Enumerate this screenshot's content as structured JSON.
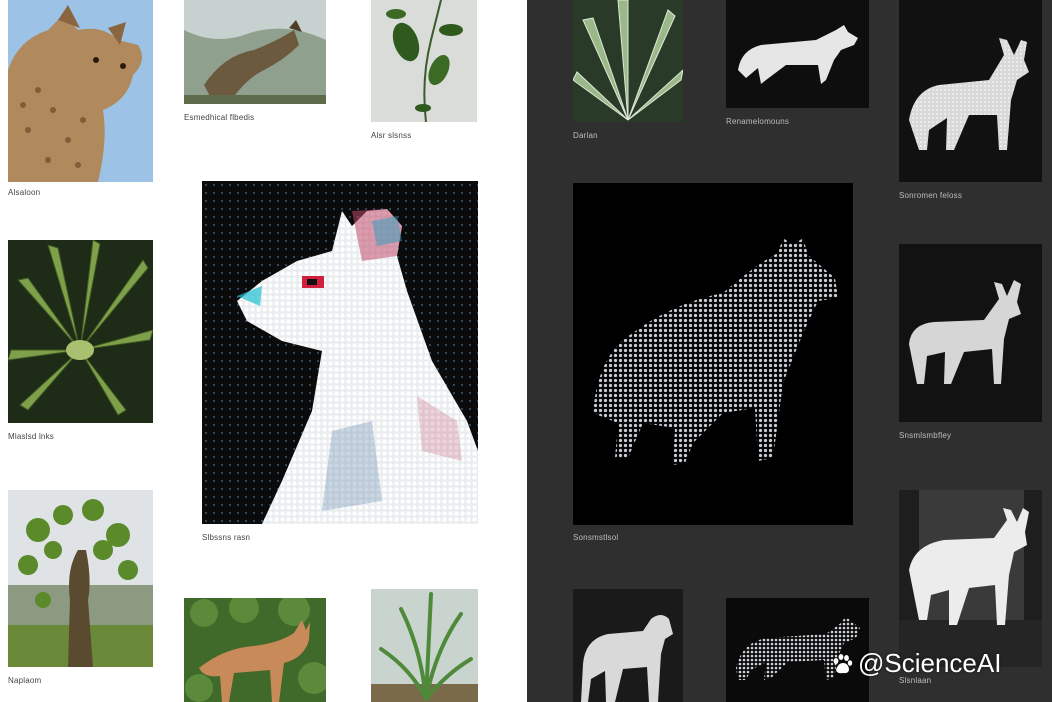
{
  "left_gallery": {
    "captions": {
      "cheetah": "Alsaloon",
      "wildcat": "Esmedhical flbedis",
      "sprig": "Alsr slsnss",
      "succulent": "Mlaslsd lnks",
      "pixel_llama": "Slbssns rasn",
      "shrub": "Naplaom"
    }
  },
  "right_gallery": {
    "captions": {
      "aloe": "Darlan",
      "white_goat": "Renamelomouns",
      "deer_top": "Sonromen feloss",
      "pixel_wolf": "Sonsmstlsol",
      "deer_mid": "Snsmlsmbfley",
      "goat_bottom": "Slsnlaan"
    }
  },
  "watermark": {
    "text": "@ScienceAI",
    "icon": "paw-icon"
  },
  "colors": {
    "left_bg": "#ffffff",
    "right_bg": "#2f2f2f"
  }
}
